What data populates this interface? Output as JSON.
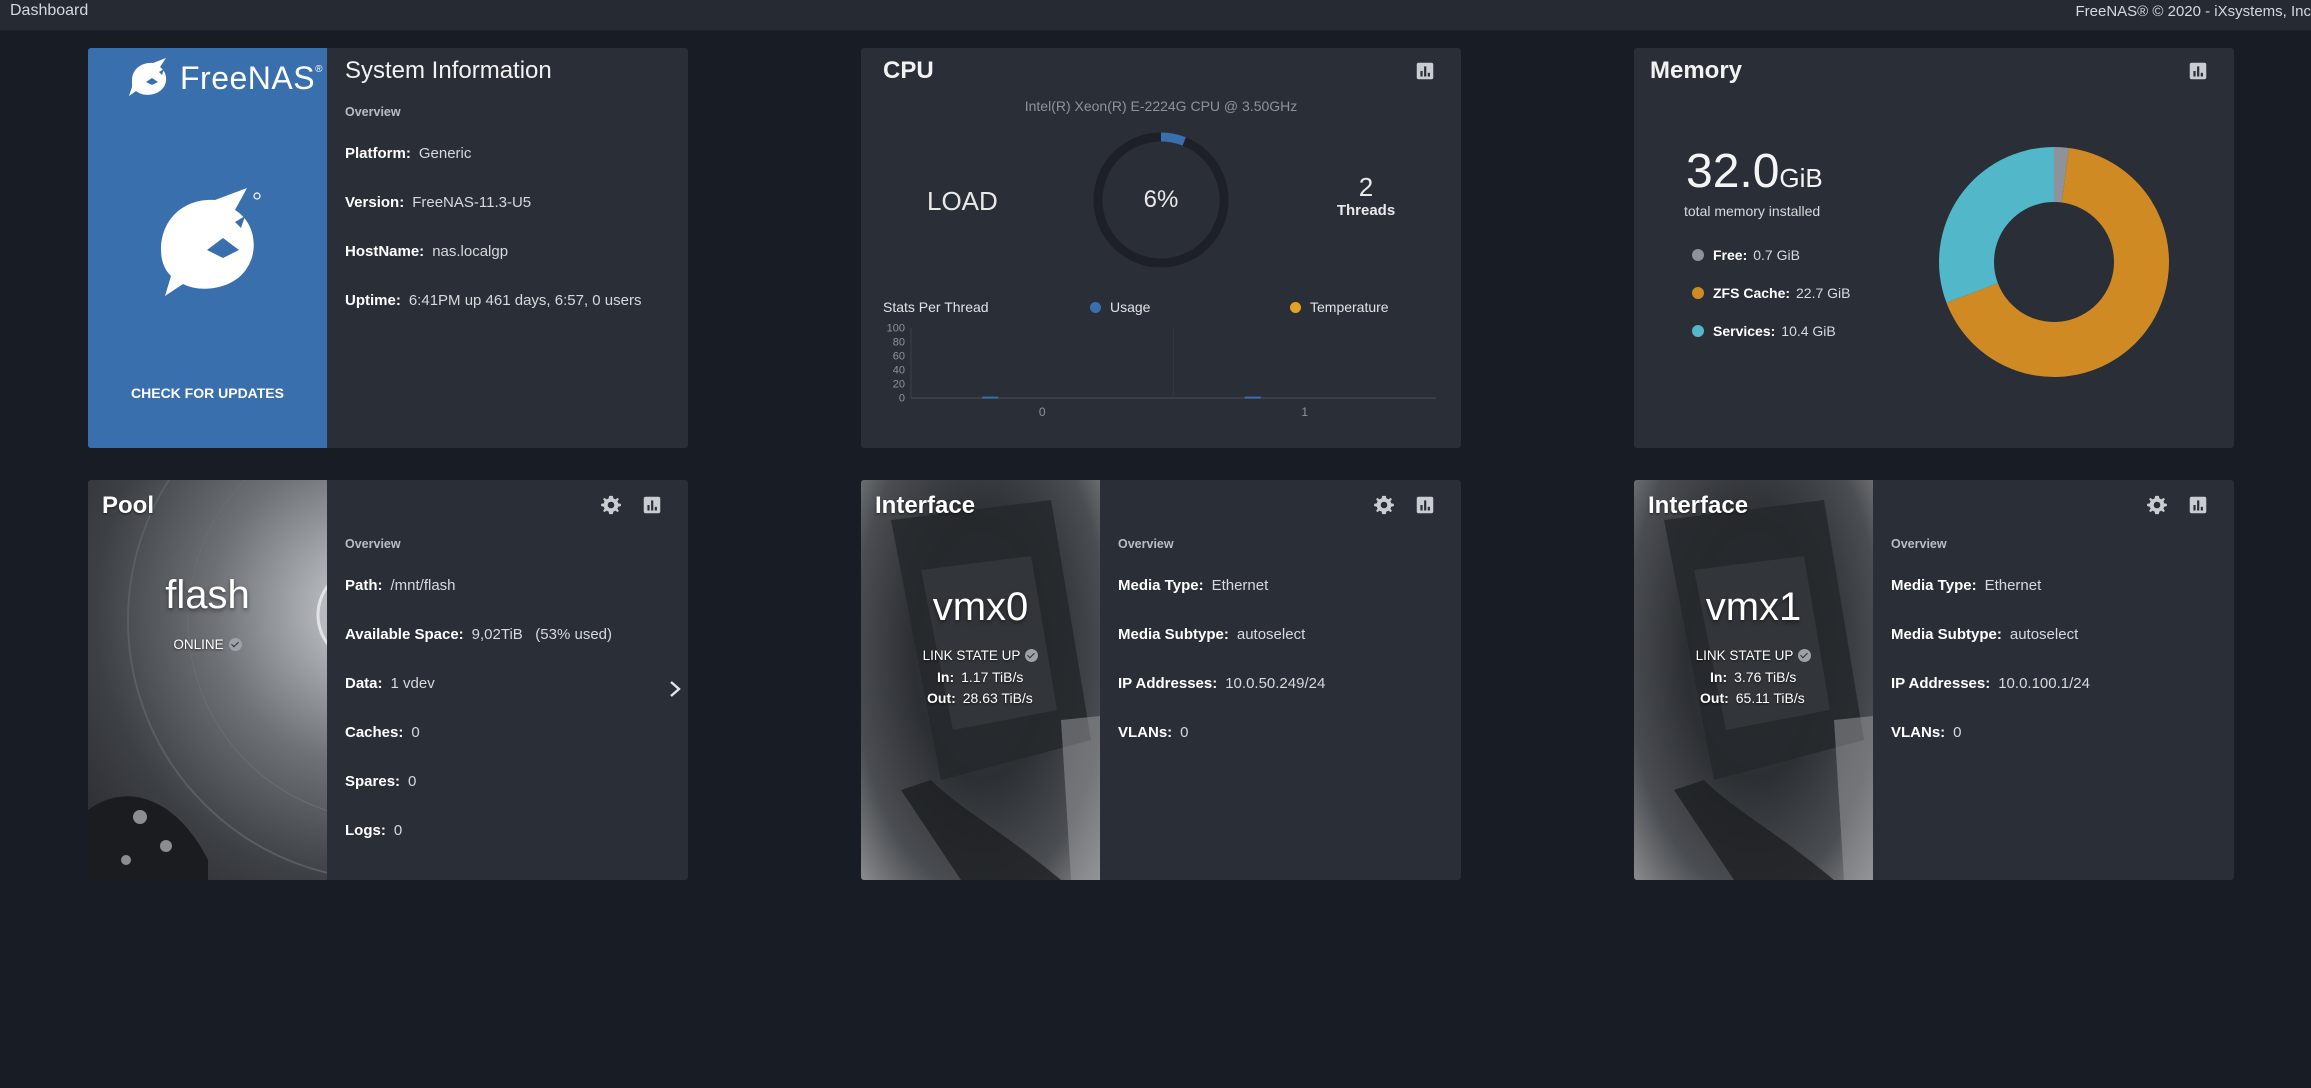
{
  "topbar": {
    "breadcrumb": "Dashboard",
    "copyright": "FreeNAS® © 2020 - iXsystems, Inc"
  },
  "sysinfo": {
    "brand": "FreeNAS",
    "brand_mark": "®",
    "title": "System Information",
    "overview": "Overview",
    "rows": [
      {
        "label": "Platform:",
        "value": "Generic"
      },
      {
        "label": "Version:",
        "value": "FreeNAS-11.3-U5"
      },
      {
        "label": "HostName:",
        "value": "nas.localgp"
      },
      {
        "label": "Uptime:",
        "value": "6:41PM up 461 days, 6:57, 0 users"
      }
    ],
    "check_updates": "CHECK FOR UPDATES"
  },
  "cpu": {
    "title": "CPU",
    "model": "Intel(R) Xeon(R) E-2224G CPU @ 3.50GHz",
    "load_label": "LOAD",
    "load_percent": 6,
    "load_text": "6%",
    "threads_count": "2",
    "threads_label": "Threads",
    "stats_title": "Stats Per Thread",
    "legend": [
      {
        "name": "Usage",
        "color": "#3a6fad"
      },
      {
        "name": "Temperature",
        "color": "#e6a023"
      }
    ],
    "chart": {
      "y_ticks": [
        "100",
        "80",
        "60",
        "40",
        "20",
        "0"
      ],
      "ylim": [
        0,
        100
      ],
      "threads": [
        "0",
        "1"
      ],
      "usage": [
        2,
        2
      ]
    }
  },
  "memory": {
    "title": "Memory",
    "total_value": "32.0",
    "total_unit": "GiB",
    "total_label": "total memory installed",
    "items": [
      {
        "label": "Free:",
        "value": "0.7 GiB",
        "amount": 0.7,
        "color": "#8e939b"
      },
      {
        "label": "ZFS Cache:",
        "value": "22.7 GiB",
        "amount": 22.7,
        "color": "#d08a24"
      },
      {
        "label": "Services:",
        "value": "10.4 GiB",
        "amount": 10.4,
        "color": "#52b7c9"
      }
    ]
  },
  "pool": {
    "title": "Pool",
    "name": "flash",
    "status": "ONLINE",
    "overview": "Overview",
    "rows": [
      {
        "label": "Path:",
        "value": "/mnt/flash"
      },
      {
        "label": "Available Space:",
        "value": "9,02TiB   (53% used)"
      },
      {
        "label": "Data:",
        "value": "1 vdev"
      },
      {
        "label": "Caches:",
        "value": "0"
      },
      {
        "label": "Spares:",
        "value": "0"
      },
      {
        "label": "Logs:",
        "value": "0"
      }
    ]
  },
  "interfaces": [
    {
      "title": "Interface",
      "name": "vmx0",
      "state": "LINK STATE UP",
      "in_label": "In:",
      "in_value": "1.17 TiB/s",
      "out_label": "Out:",
      "out_value": "28.63 TiB/s",
      "overview": "Overview",
      "rows": [
        {
          "label": "Media Type:",
          "value": "Ethernet"
        },
        {
          "label": "Media Subtype:",
          "value": "autoselect"
        },
        {
          "label": "IP Addresses:",
          "value": "10.0.50.249/24"
        },
        {
          "label": "VLANs:",
          "value": "0"
        }
      ]
    },
    {
      "title": "Interface",
      "name": "vmx1",
      "state": "LINK STATE UP",
      "in_label": "In:",
      "in_value": "3.76 TiB/s",
      "out_label": "Out:",
      "out_value": "65.11 TiB/s",
      "overview": "Overview",
      "rows": [
        {
          "label": "Media Type:",
          "value": "Ethernet"
        },
        {
          "label": "Media Subtype:",
          "value": "autoselect"
        },
        {
          "label": "IP Addresses:",
          "value": "10.0.100.1/24"
        },
        {
          "label": "VLANs:",
          "value": "0"
        }
      ]
    }
  ]
}
